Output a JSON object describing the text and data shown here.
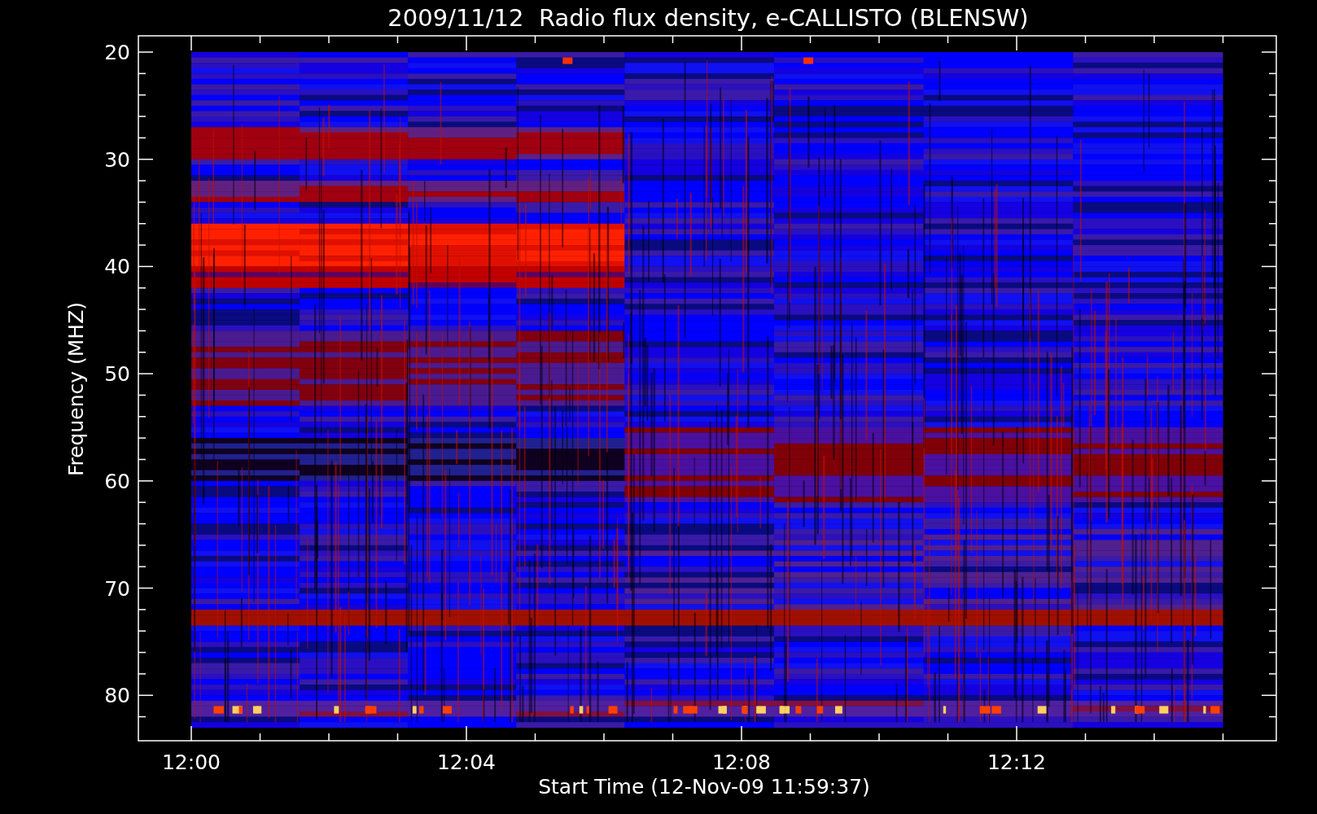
{
  "title": "2009/11/12  Radio flux density, e-CALLISTO (BLENSW)",
  "plot": {
    "ylabel": "Frequency (MHZ)",
    "xlabel": "Start Time (12-Nov-09 11:59:37)",
    "yticks": [
      "20",
      "30",
      "40",
      "50",
      "60",
      "70",
      "80"
    ],
    "xticks": [
      "12:00",
      "12:04",
      "12:08",
      "12:12"
    ]
  }
}
